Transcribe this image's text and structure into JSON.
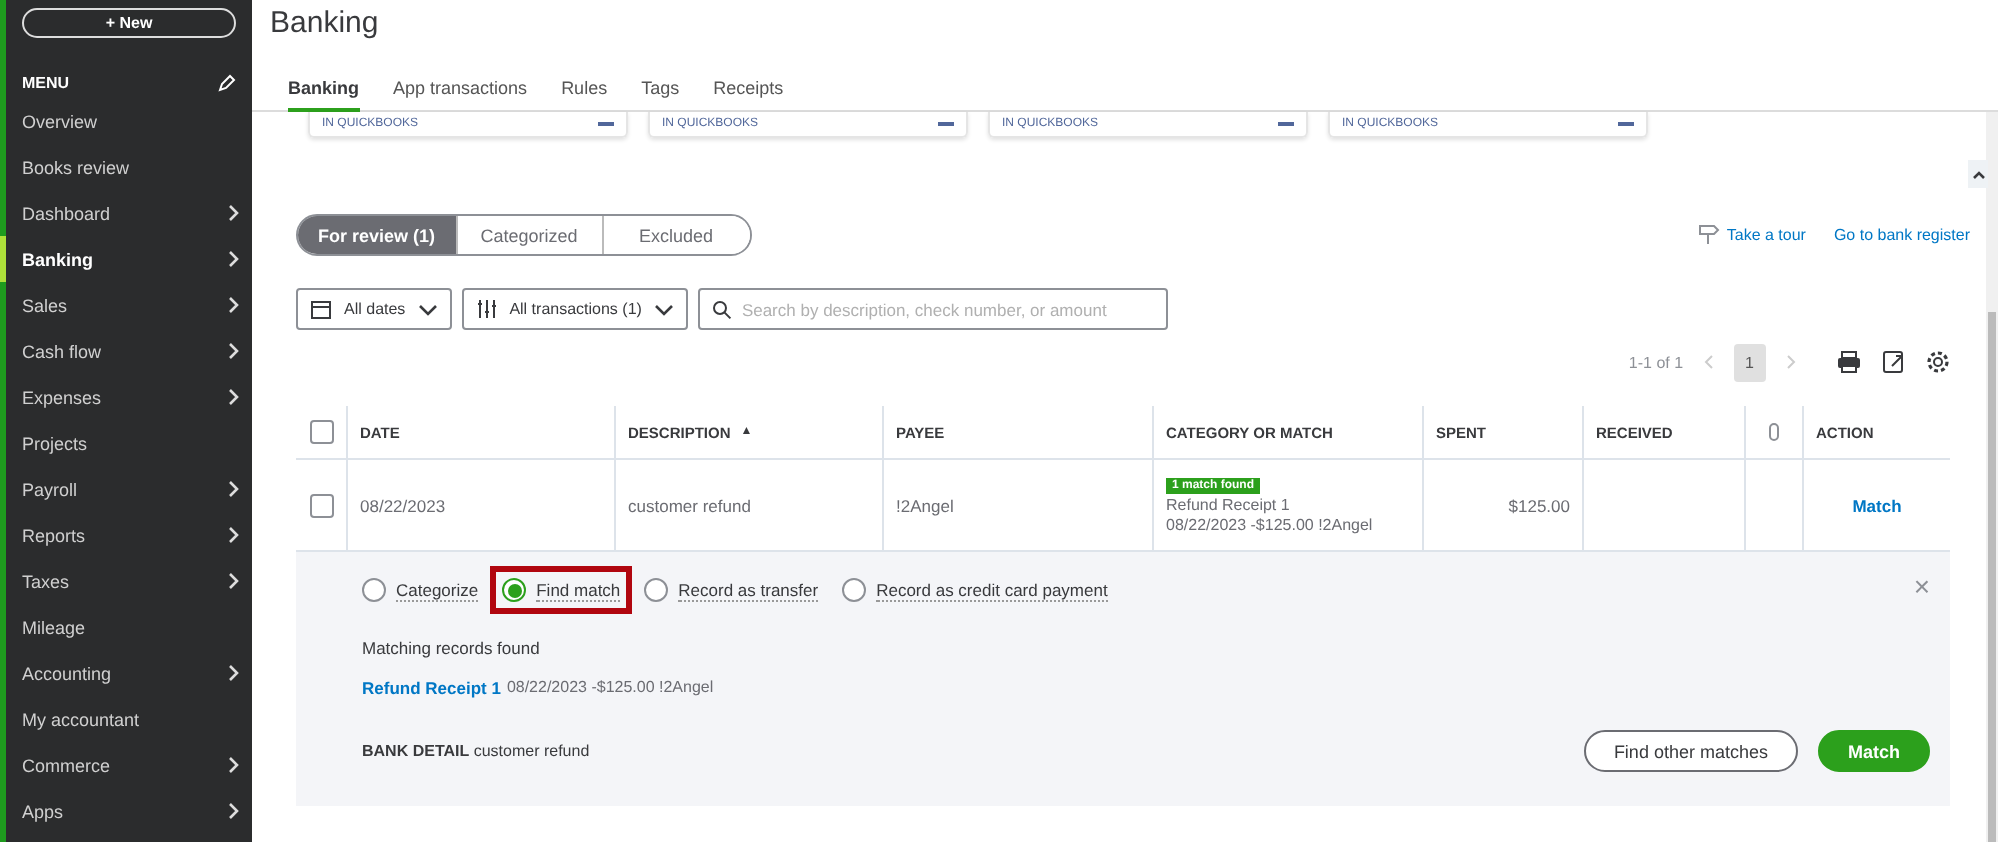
{
  "sidebar": {
    "new_button": "+ New",
    "menu_label": "MENU",
    "items": [
      {
        "label": "Overview",
        "selected": false,
        "has_children": false
      },
      {
        "label": "Books review",
        "selected": false,
        "has_children": false
      },
      {
        "label": "Dashboard",
        "selected": false,
        "has_children": true
      },
      {
        "label": "Banking",
        "selected": true,
        "has_children": true
      },
      {
        "label": "Sales",
        "selected": false,
        "has_children": true
      },
      {
        "label": "Cash flow",
        "selected": false,
        "has_children": true
      },
      {
        "label": "Expenses",
        "selected": false,
        "has_children": true
      },
      {
        "label": "Projects",
        "selected": false,
        "has_children": false
      },
      {
        "label": "Payroll",
        "selected": false,
        "has_children": true
      },
      {
        "label": "Reports",
        "selected": false,
        "has_children": true
      },
      {
        "label": "Taxes",
        "selected": false,
        "has_children": true
      },
      {
        "label": "Mileage",
        "selected": false,
        "has_children": false
      },
      {
        "label": "Accounting",
        "selected": false,
        "has_children": true
      },
      {
        "label": "My accountant",
        "selected": false,
        "has_children": false
      },
      {
        "label": "Commerce",
        "selected": false,
        "has_children": true
      },
      {
        "label": "Apps",
        "selected": false,
        "has_children": true
      }
    ]
  },
  "page_title": "Banking",
  "tabs": [
    {
      "label": "Banking",
      "selected": true
    },
    {
      "label": "App transactions",
      "selected": false
    },
    {
      "label": "Rules",
      "selected": false
    },
    {
      "label": "Tags",
      "selected": false
    },
    {
      "label": "Receipts",
      "selected": false
    }
  ],
  "account_cards": [
    {
      "label": "IN QUICKBOOKS"
    },
    {
      "label": "IN QUICKBOOKS"
    },
    {
      "label": "IN QUICKBOOKS"
    },
    {
      "label": "IN QUICKBOOKS"
    }
  ],
  "review_tabs": [
    {
      "label": "For review (1)",
      "selected": true
    },
    {
      "label": "Categorized",
      "selected": false
    },
    {
      "label": "Excluded",
      "selected": false
    }
  ],
  "links": {
    "tour": "Take a tour",
    "register": "Go to bank register"
  },
  "filters": {
    "dates": "All dates",
    "transactions": "All transactions (1)",
    "search_placeholder": "Search by description, check number, or amount"
  },
  "pagination": {
    "range": "1-1 of 1",
    "page": "1"
  },
  "table": {
    "select_all_checked": false,
    "columns": [
      "DATE",
      "DESCRIPTION",
      "PAYEE",
      "CATEGORY OR MATCH",
      "SPENT",
      "RECEIVED",
      "ACTION"
    ],
    "sort_mark": "▲",
    "rows": [
      {
        "checked": false,
        "date": "08/22/2023",
        "description": "customer refund",
        "payee": "!2Angel",
        "badge": "1 match found",
        "match_line_1": "Refund Receipt 1",
        "match_line_2": "08/22/2023 -$125.00 !2Angel",
        "spent": "$125.00",
        "action": "Match"
      }
    ]
  },
  "detail": {
    "options": [
      {
        "label": "Categorize",
        "selected": false,
        "highlighted": false
      },
      {
        "label": "Find match",
        "selected": true,
        "highlighted": true
      },
      {
        "label": "Record as transfer",
        "selected": false,
        "highlighted": false
      },
      {
        "label": "Record as credit card payment",
        "selected": false,
        "highlighted": false
      }
    ],
    "close": "×",
    "records_heading": "Matching records found",
    "record_link": "Refund Receipt 1",
    "record_info": "08/22/2023 -$125.00 !2Angel",
    "bank_detail": "**BANK DETAIL** customer refund",
    "buttons": [
      {
        "label": "Find other matches",
        "kind": "secondary"
      },
      {
        "label": "Match",
        "kind": "primary"
      }
    ]
  }
}
